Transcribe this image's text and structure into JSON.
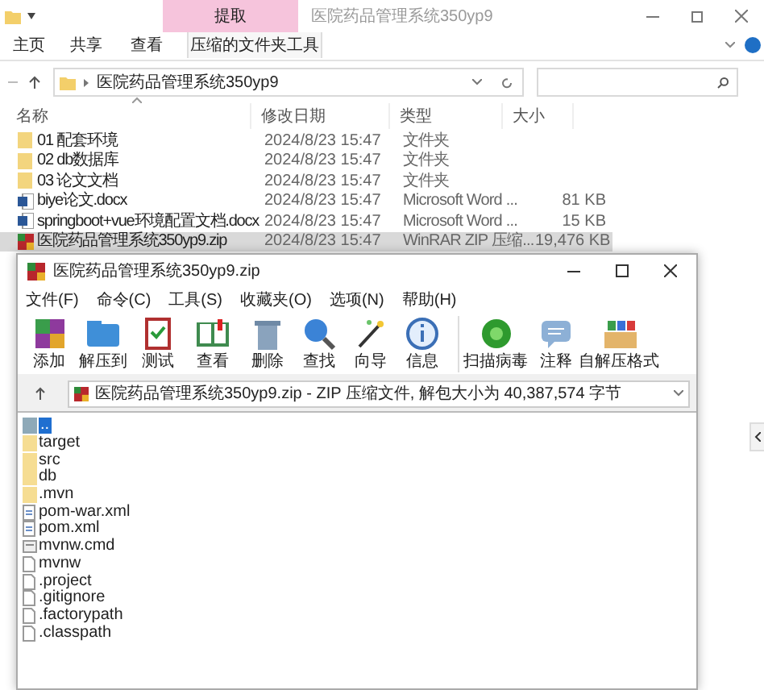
{
  "explorer": {
    "context_tab": "提取",
    "title": "医院药品管理系统350yp9",
    "ribbon_tabs": [
      {
        "label": "主页",
        "selected": false
      },
      {
        "label": "共享",
        "selected": false
      },
      {
        "label": "查看",
        "selected": false
      },
      {
        "label": "压缩的文件夹工具",
        "selected": true
      }
    ],
    "address": {
      "path": "医院药品管理系统350yp9"
    },
    "columns": [
      "名称",
      "修改日期",
      "类型",
      "大小"
    ],
    "files": [
      {
        "kind": "folder",
        "name": "01 配套环境",
        "modified": "2024/8/23 15:47",
        "type": "文件夹",
        "selected": false
      },
      {
        "kind": "folder",
        "name": "02 db数据库",
        "modified": "2024/8/23 15:47",
        "type": "文件夹",
        "selected": false
      },
      {
        "kind": "folder",
        "name": "03 论文文档",
        "modified": "2024/8/23 15:47",
        "type": "文件夹",
        "selected": false
      },
      {
        "kind": "word",
        "name": "biye论文.docx",
        "modified": "2024/8/23 15:47",
        "type": "Microsoft Word ...",
        "size": "81 KB",
        "selected": false
      },
      {
        "kind": "word",
        "name": "springboot+vue环境配置文档.docx",
        "modified": "2024/8/23 15:47",
        "type": "Microsoft Word ...",
        "size": "15 KB",
        "selected": false
      },
      {
        "kind": "archive",
        "name": "医院药品管理系统350yp9.zip",
        "modified": "2024/8/23 15:47",
        "type": "WinRAR ZIP 压缩...",
        "size": "19,476 KB",
        "selected": true
      }
    ]
  },
  "winrar": {
    "title": "医院药品管理系统350yp9.zip",
    "menu": [
      "文件(F)",
      "命令(C)",
      "工具(S)",
      "收藏夹(O)",
      "选项(N)",
      "帮助(H)"
    ],
    "toolbar": [
      "添加",
      "解压到",
      "测试",
      "查看",
      "删除",
      "查找",
      "向导",
      "信息",
      "扫描病毒",
      "注释",
      "自解压格式"
    ],
    "archive_info": "医院药品管理系统350yp9.zip - ZIP 压缩文件, 解包大小为 40,387,574 字节",
    "items": [
      {
        "kind": "up",
        "name": "..",
        "selected": true
      },
      {
        "kind": "folder",
        "name": "target",
        "selected": false
      },
      {
        "kind": "folder",
        "name": "src",
        "selected": false
      },
      {
        "kind": "folder",
        "name": "db",
        "selected": false
      },
      {
        "kind": "folder",
        "name": ".mvn",
        "selected": false
      },
      {
        "kind": "xml",
        "name": "pom-war.xml",
        "selected": false
      },
      {
        "kind": "xml",
        "name": "pom.xml",
        "selected": false
      },
      {
        "kind": "cmd",
        "name": "mvnw.cmd",
        "selected": false
      },
      {
        "kind": "file",
        "name": "mvnw",
        "selected": false
      },
      {
        "kind": "file",
        "name": ".project",
        "selected": false
      },
      {
        "kind": "file",
        "name": ".gitignore",
        "selected": false
      },
      {
        "kind": "file",
        "name": ".factorypath",
        "selected": false
      },
      {
        "kind": "file",
        "name": ".classpath",
        "selected": false
      }
    ]
  }
}
